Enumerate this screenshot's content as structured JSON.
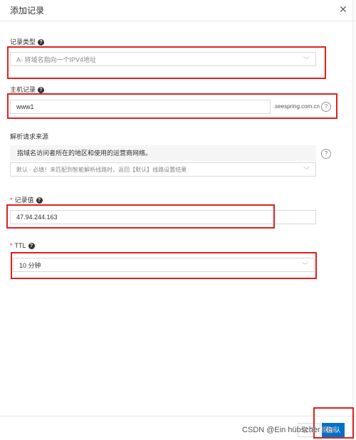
{
  "dialog": {
    "title": "添加记录",
    "close_icon": "close-icon"
  },
  "record_type": {
    "label": "记录类型",
    "value": "A- 将域名指向一个IPV4地址"
  },
  "host_record": {
    "label": "主机记录",
    "value": "www1",
    "domain_suffix": ".seespring.com.cn"
  },
  "resolve_source": {
    "label": "解析请求来源",
    "tooltip_text": "指域名访问者所在的地区和使用的运营商网络。",
    "value": "默认 - 必填！未匹配到智能解析线路时，返回【默认】线路设置结果"
  },
  "record_value": {
    "required_mark": "*",
    "label": "记录值",
    "value": "47.94.244.163"
  },
  "ttl": {
    "required_mark": "*",
    "label": "TTL",
    "value": "10 分钟"
  },
  "footer": {
    "cancel_label": "取 消",
    "confirm_label": "确 认"
  },
  "watermark": "CSDN @Ein hübscher Kerl",
  "colors": {
    "highlight": "#e0201f",
    "primary": "#0070cc"
  }
}
